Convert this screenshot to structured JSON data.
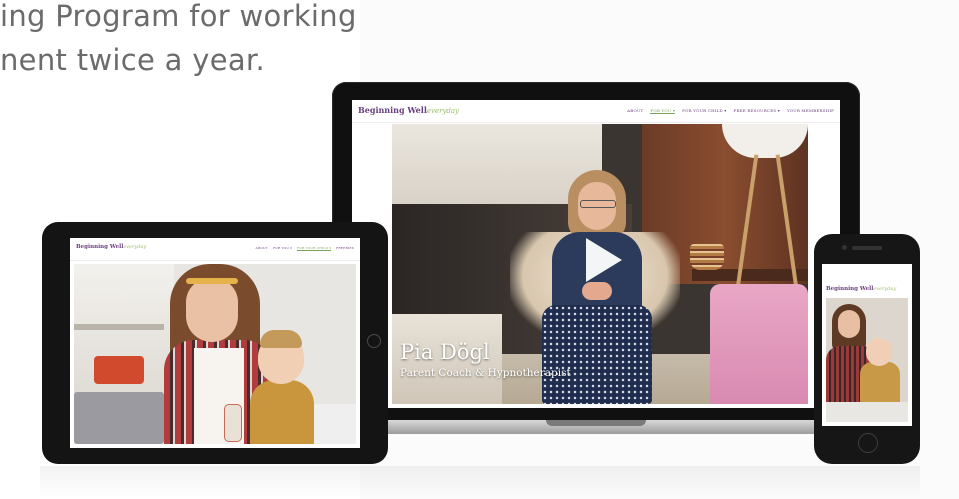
{
  "intro": {
    "line1": "ing Program for working",
    "line2": "nent twice a year."
  },
  "site": {
    "logo_main": "Beginning Well",
    "logo_script": "everyday",
    "nav_laptop": [
      "ABOUT",
      "FOR YOU ▾",
      "FOR YOUR CHILD ▾",
      "FREE RESOURCES ▾",
      "YOUR MEMBERSHIP"
    ],
    "nav_tablet": [
      "ABOUT",
      "FOR YOU ▾",
      "FOR YOUR CHILD ▾",
      "FREEBIES"
    ]
  },
  "video": {
    "name": "Pia Dögl",
    "role": "Parent Coach & Hypnotherapist",
    "play_icon": "play-icon"
  },
  "colors": {
    "brand_purple": "#6a3e7e",
    "brand_green": "#7aa35a",
    "accent_arc": "#a7d381"
  }
}
